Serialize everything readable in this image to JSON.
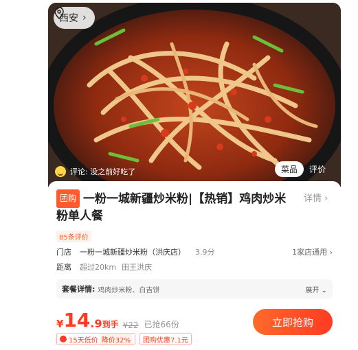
{
  "hero": {
    "location": "西安",
    "review_hint": "评论: 没之前好吃了",
    "tabs": [
      {
        "label": "菜品",
        "active": true
      },
      {
        "label": "评价",
        "active": false
      }
    ]
  },
  "deal": {
    "badge": "团购",
    "title": "一粉一城新疆炒米粉|【热销】鸡肉炒米粉单人餐",
    "detail_link": "详情",
    "review_tag": "85条评价",
    "store_label": "门店",
    "store_name": "一粉一城新疆炒米粉（洪庆店）",
    "score": "3.9分",
    "store_count": "1家店通用",
    "distance_label": "距离",
    "distance_value": "超过20km",
    "area": "田王洪庆",
    "package_label": "套餐详情:",
    "package_items": "鸡肉炒米粉、白吉饼",
    "package_expand": "展开",
    "currency": "¥",
    "price_int": "14",
    "price_dec": ".9",
    "price_suffix": "到手",
    "original_price": "¥22",
    "sold": "已抢66份",
    "buy_label": "立即抢购",
    "chip1_a": "15天低价",
    "chip1_b": "降价32%",
    "chip2": "团购优惠7.1元"
  },
  "colors": {
    "accent": "#ff3a20",
    "badge": "#ff5b2e"
  }
}
